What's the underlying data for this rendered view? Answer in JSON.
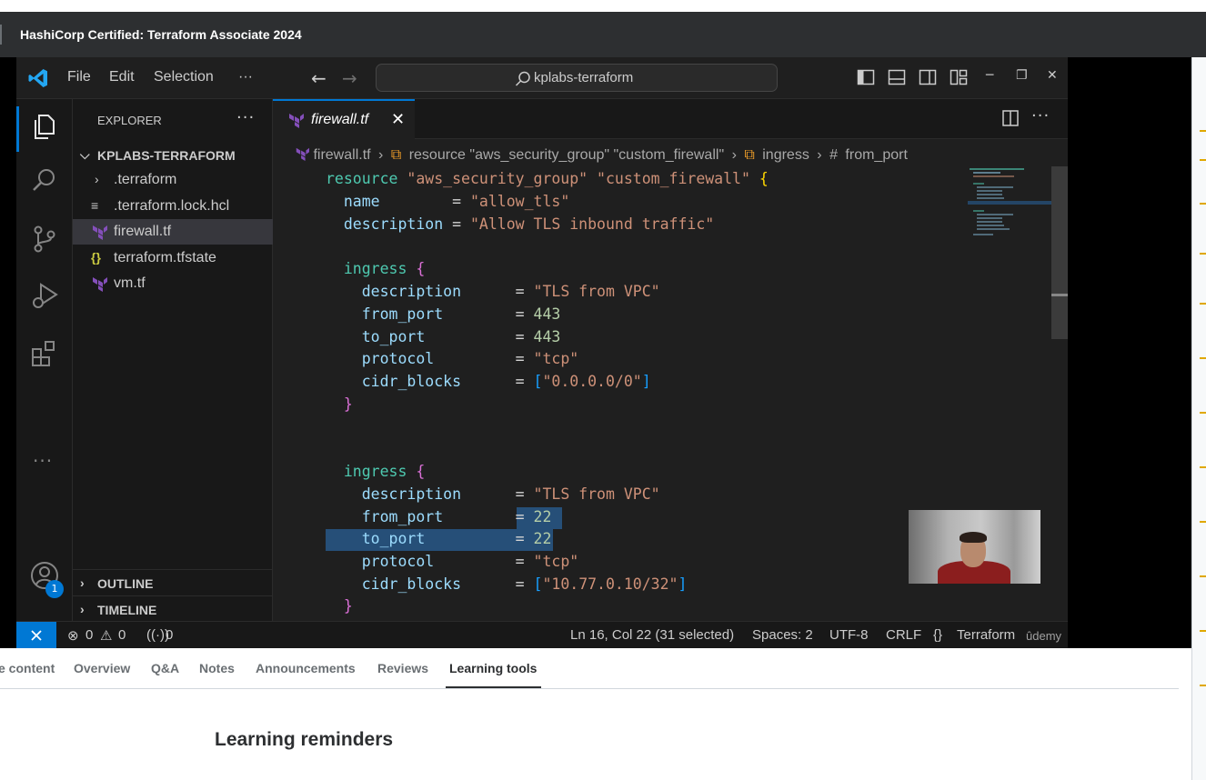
{
  "course": {
    "title": "HashiCorp Certified: Terraform Associate 2024"
  },
  "vscode": {
    "menu": [
      "File",
      "Edit",
      "Selection",
      "···"
    ],
    "search_label": "kplabs-terraform",
    "explorer": {
      "title": "EXPLORER",
      "more": "···",
      "folder": "KPLABS-TERRAFORM",
      "files": [
        ".terraform",
        ".terraform.lock.hcl",
        "firewall.tf",
        "terraform.tfstate",
        "vm.tf"
      ],
      "sections": [
        "OUTLINE",
        "TIMELINE"
      ]
    },
    "account_badge": "1",
    "tab": {
      "label": "firewall.tf",
      "close": "✕",
      "more": "···"
    },
    "breadcrumbs": [
      "firewall.tf",
      "resource \"aws_security_group\" \"custom_firewall\"",
      "ingress",
      "from_port"
    ],
    "code": {
      "l1_kw": "resource",
      "l1_s1": "\"aws_security_group\"",
      "l1_s2": "\"custom_firewall\"",
      "l1_b": "{",
      "l2_p": "name",
      "l2_eq": "=",
      "l2_v": "\"allow_tls\"",
      "l3_p": "description",
      "l3_eq": "=",
      "l3_v": "\"Allow TLS inbound traffic\"",
      "l5_kw": "ingress",
      "l5_b": "{",
      "l6_p": "description",
      "l6_eq": "=",
      "l6_v": "\"TLS from VPC\"",
      "l7_p": "from_port",
      "l7_eq": "=",
      "l7_v": "443",
      "l8_p": "to_port",
      "l8_eq": "=",
      "l8_v": "443",
      "l9_p": "protocol",
      "l9_eq": "=",
      "l9_v": "\"tcp\"",
      "l10_p": "cidr_blocks",
      "l10_eq": "=",
      "l10_b1": "[",
      "l10_v": "\"0.0.0.0/0\"",
      "l10_b2": "]",
      "l11_b": "}",
      "l14_kw": "ingress",
      "l14_b": "{",
      "l15_p": "description",
      "l15_eq": "=",
      "l15_v": "\"TLS from VPC\"",
      "l16_p": "from_port",
      "l16_eq": "=",
      "l16_v": "22",
      "l17_p": "to_port",
      "l17_eq": "=",
      "l17_v": "22",
      "l18_p": "protocol",
      "l18_eq": "=",
      "l18_v": "\"tcp\"",
      "l19_p": "cidr_blocks",
      "l19_eq": "=",
      "l19_b1": "[",
      "l19_v": "\"10.77.0.10/32\"",
      "l19_b2": "]",
      "l20_b": "}"
    },
    "status": {
      "errors": "0",
      "warnings": "0",
      "ports": "0",
      "position": "Ln 16, Col 22 (31 selected)",
      "spaces": "Spaces: 2",
      "encoding": "UTF-8",
      "eol": "CRLF",
      "language_icon": "{}",
      "language": "Terraform",
      "watermark": "ûdemy"
    }
  },
  "udemy": {
    "tabs": [
      "e content",
      "Overview",
      "Q&A",
      "Notes",
      "Announcements",
      "Reviews",
      "Learning tools"
    ],
    "active_tab": "Learning tools",
    "section_title": "Learning reminders"
  },
  "colors": {
    "accent": "#0078d4",
    "selection": "#264f78",
    "keyword": "#4ec9b0",
    "string": "#ce9178",
    "property": "#9cdcfe",
    "number": "#b5cea8"
  }
}
